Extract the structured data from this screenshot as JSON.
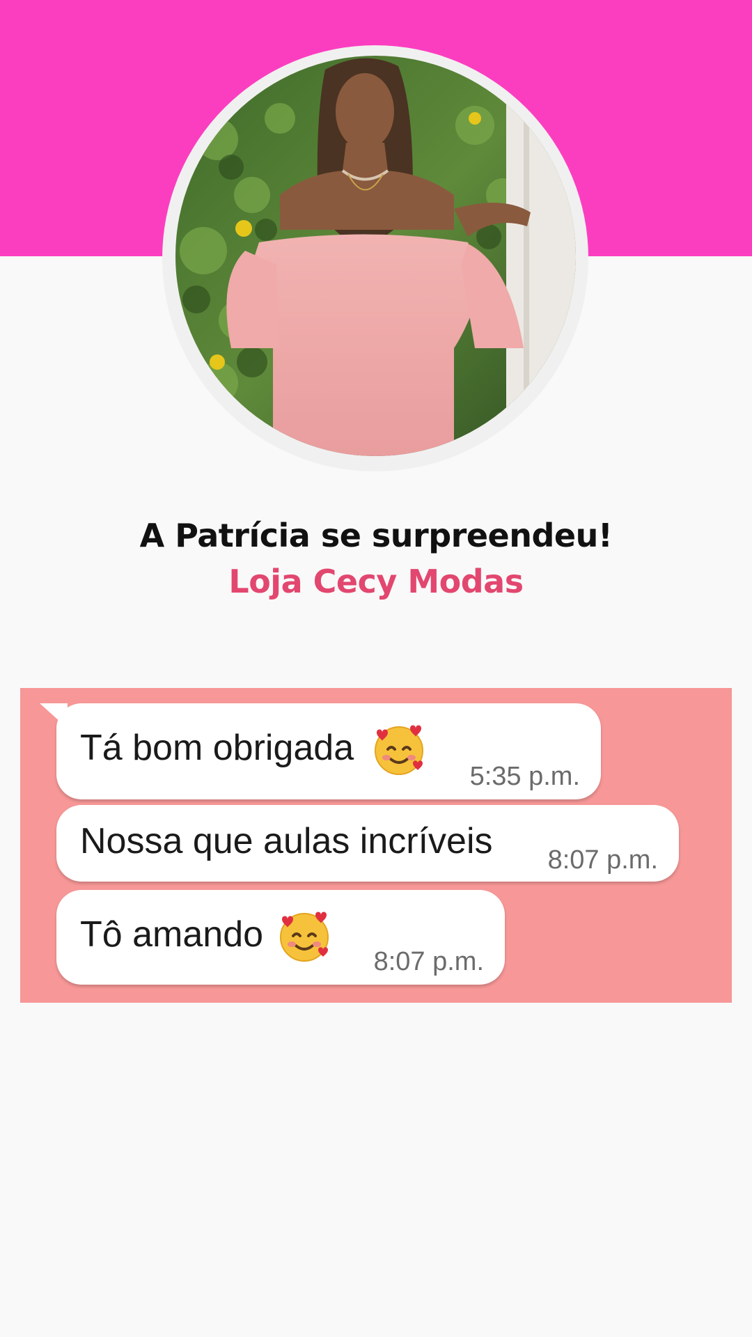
{
  "colors": {
    "header_band": "#fb3ec0",
    "page_background": "#f9f9f9",
    "subtitle": "#e2476f",
    "chat_background": "#f79797",
    "bubble": "#ffffff"
  },
  "profile": {
    "photo_alt": "Mulher com vestido rosa ombro a ombro"
  },
  "headline": "A Patrícia se surpreendeu!",
  "subtitle": "Loja Cecy Modas",
  "chat": {
    "messages": [
      {
        "text": "Tá bom obrigada",
        "emoji": "smiling-face-with-hearts-icon",
        "time": "5:35 p.m."
      },
      {
        "text": "Nossa que aulas incríveis",
        "emoji": "",
        "time": "8:07 p.m."
      },
      {
        "text": "Tô amando",
        "emoji": "smiling-face-with-hearts-icon",
        "time": "8:07 p.m."
      }
    ]
  }
}
